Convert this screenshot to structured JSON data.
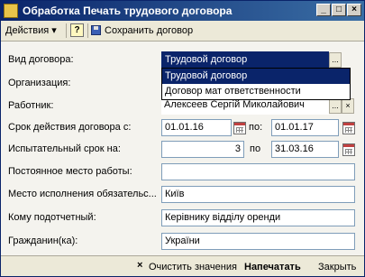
{
  "window": {
    "title": "Обработка  Печать трудового договора",
    "controls": [
      "_",
      "□",
      "×"
    ]
  },
  "toolbar": {
    "actions_label": "Действия",
    "help_label": "?",
    "save_label": "Сохранить договор"
  },
  "form": {
    "contract_type": {
      "label": "Вид договора:",
      "value": "Трудовой договор"
    },
    "organization": {
      "label": "Организация:",
      "value": ""
    },
    "employee": {
      "label": "Работник:",
      "value": "Алексеев  Сергій Миколайович"
    },
    "term": {
      "label": "Срок действия договора с:",
      "from": "01.01.16",
      "to_label": "по:",
      "to": "01.01.17"
    },
    "probation": {
      "label": "Испытательный срок на:",
      "value": "3",
      "to_label": "по",
      "to": "31.03.16"
    },
    "permanent_place": {
      "label": "Постоянное место работы:",
      "value": ""
    },
    "execution_place": {
      "label": "Место исполнения обязательс...",
      "value": "Київ"
    },
    "reports_to": {
      "label": "Кому подотчетный:",
      "value": "Керівнику відділу оренди"
    },
    "citizenship": {
      "label": "Гражданин(ка):",
      "value": "України"
    }
  },
  "dropdown": {
    "options": [
      "Трудовой договор",
      "Договор мат ответственности"
    ],
    "selected_index": 0
  },
  "footer": {
    "clear_label": "Очистить значения",
    "print_label": "Напечатать",
    "close_label": "Закрыть"
  }
}
